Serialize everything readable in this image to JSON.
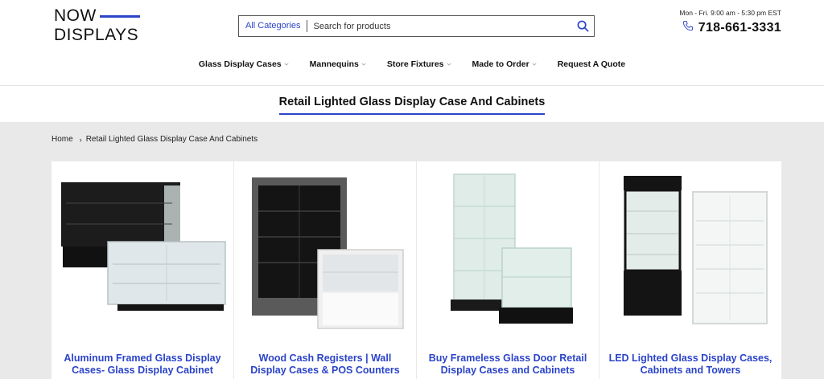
{
  "brand": {
    "line1": "NOW",
    "line2": "DISPLAYS"
  },
  "search": {
    "category": "All Categories",
    "placeholder": "Search for products"
  },
  "contact": {
    "hours": "Mon - Fri. 9:00 am - 5:30 pm EST",
    "phone": "718-661-3331"
  },
  "nav": {
    "items": [
      {
        "label": "Glass Display Cases",
        "dropdown": true
      },
      {
        "label": "Mannequins",
        "dropdown": true
      },
      {
        "label": "Store Fixtures",
        "dropdown": true
      },
      {
        "label": "Made to Order",
        "dropdown": true
      },
      {
        "label": "Request A Quote",
        "dropdown": false
      }
    ]
  },
  "page": {
    "title": "Retail Lighted Glass Display Case And Cabinets"
  },
  "breadcrumb": {
    "home": "Home",
    "separator": "›",
    "current": "Retail Lighted Glass Display Case And Cabinets"
  },
  "products": [
    {
      "title": "Aluminum Framed Glass Display Cases- Glass Display Cabinet"
    },
    {
      "title": "Wood Cash Registers | Wall Display Cases & POS Counters"
    },
    {
      "title": "Buy Frameless Glass Door Retail Display Cases and Cabinets"
    },
    {
      "title": "LED Lighted Glass Display Cases, Cabinets and Towers"
    }
  ],
  "colors": {
    "accent": "#2b44c9",
    "background": "#e9e9e9"
  },
  "icons": {
    "search": "search-icon",
    "phone": "phone-icon",
    "chevron": "chevron-down-icon"
  }
}
